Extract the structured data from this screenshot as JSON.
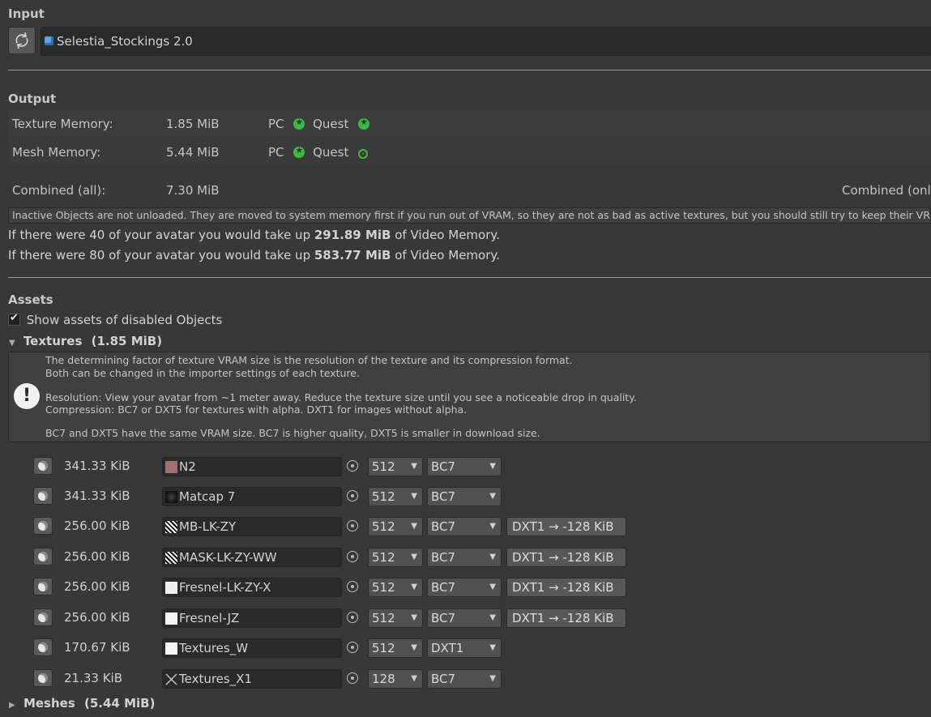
{
  "input": {
    "title": "Input",
    "avatar_name": "Selestia_Stockings 2.0"
  },
  "output": {
    "title": "Output",
    "texture_label": "Texture Memory:",
    "texture_value": "1.85 MiB",
    "mesh_label": "Mesh Memory:",
    "mesh_value": "5.44 MiB",
    "pc_label": "PC",
    "quest_label": "Quest",
    "combined_label": "Combined (all):",
    "combined_value": "7.30 MiB",
    "combined_only_label": "Combined (onl",
    "inactive_note": "Inactive Objects are not unloaded. They are moved to system memory first if you run out of VRAM, so they are not as bad as active textures, but you should still try to keep their VRA",
    "line40_prefix": "If there were 40 of your avatar you would take up ",
    "line40_value": "291.89 MiB",
    "line40_suffix": " of Video Memory.",
    "line80_prefix": "If there were 80 of your avatar you would take up ",
    "line80_value": "583.77 MiB",
    "line80_suffix": " of Video Memory."
  },
  "assets": {
    "title": "Assets",
    "show_disabled_label": "Show assets of disabled Objects",
    "show_disabled_checked": true,
    "textures_label": "Textures",
    "textures_size": "(1.85 MiB)",
    "meshes_label": "Meshes",
    "meshes_size": "(5.44 MiB)",
    "info_lines": [
      "The determining factor of texture VRAM size is the resolution of the texture and its compression format.",
      "Both can be changed in the importer settings of each texture.",
      "Resolution: View your avatar from ~1 meter away. Reduce the texture size until you see a noticeable drop in quality.",
      "Compression: BC7 or DXT5 for textures with alpha. DXT1 for images without alpha.",
      "BC7 and DXT5 have the same VRAM size. BC7 is higher quality, DXT5 is smaller in download size."
    ],
    "textures": [
      {
        "size": "341.33 KiB",
        "name": "N2",
        "resolution": "512",
        "format": "BC7",
        "suggestion": "",
        "thumb": "pink-swatch-icon"
      },
      {
        "size": "341.33 KiB",
        "name": "Matcap 7",
        "resolution": "512",
        "format": "BC7",
        "suggestion": "",
        "thumb": "matcap-icon"
      },
      {
        "size": "256.00 KiB",
        "name": "MB-LK-ZY",
        "resolution": "512",
        "format": "BC7",
        "suggestion": "DXT1 → -128 KiB",
        "thumb": "pattern-icon"
      },
      {
        "size": "256.00 KiB",
        "name": "MASK-LK-ZY-WW",
        "resolution": "512",
        "format": "BC7",
        "suggestion": "DXT1 → -128 KiB",
        "thumb": "pattern-icon"
      },
      {
        "size": "256.00 KiB",
        "name": "Fresnel-LK-ZY-X",
        "resolution": "512",
        "format": "BC7",
        "suggestion": "DXT1 → -128 KiB",
        "thumb": "white-dots-icon"
      },
      {
        "size": "256.00 KiB",
        "name": "Fresnel-JZ",
        "resolution": "512",
        "format": "BC7",
        "suggestion": "DXT1 → -128 KiB",
        "thumb": "white-swatch-icon"
      },
      {
        "size": "170.67 KiB",
        "name": "Textures_W",
        "resolution": "512",
        "format": "DXT1",
        "suggestion": "",
        "thumb": "white-swatch-icon"
      },
      {
        "size": "21.33 KiB",
        "name": "Textures_X1",
        "resolution": "128",
        "format": "BC7",
        "suggestion": "",
        "thumb": "cross-icon"
      }
    ]
  }
}
